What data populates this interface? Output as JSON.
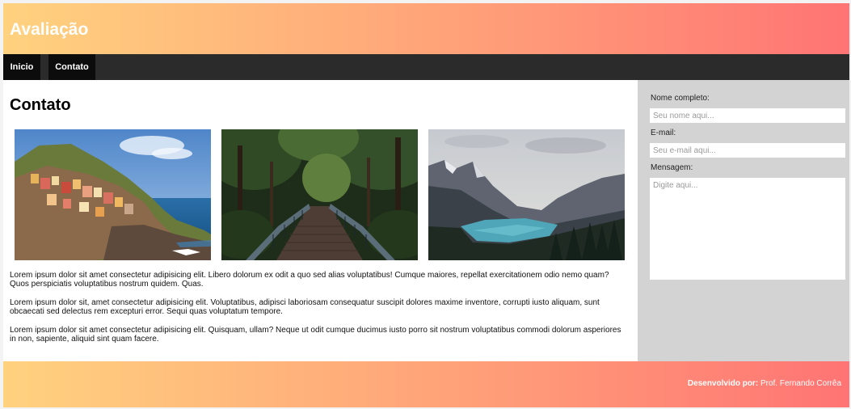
{
  "header": {
    "title": "Avaliação"
  },
  "nav": {
    "items": [
      {
        "label": "Inicio"
      },
      {
        "label": "Contato"
      }
    ]
  },
  "main": {
    "heading": "Contato",
    "images": [
      {
        "alt": "coastal cliff village"
      },
      {
        "alt": "bridge in forest"
      },
      {
        "alt": "mountain lake"
      }
    ],
    "paragraphs": [
      "Lorem ipsum dolor sit amet consectetur adipisicing elit. Libero dolorum ex odit a quo sed alias voluptatibus! Cumque maiores, repellat exercitationem odio nemo quam? Quos perspiciatis voluptatibus nostrum quidem. Quas.",
      "Lorem ipsum dolor sit, amet consectetur adipisicing elit. Voluptatibus, adipisci laboriosam consequatur suscipit dolores maxime inventore, corrupti iusto aliquam, sunt obcaecati sed delectus rem excepturi error. Sequi quas voluptatum tempore.",
      "Lorem ipsum dolor sit amet consectetur adipisicing elit. Quisquam, ullam? Neque ut odit cumque ducimus iusto porro sit nostrum voluptatibus commodi dolorum asperiores in non, sapiente, aliquid sint quam facere."
    ]
  },
  "form": {
    "name_label": "Nome completo:",
    "name_placeholder": "Seu nome aqui...",
    "email_label": "E-mail:",
    "email_placeholder": "Seu e-mail aqui...",
    "message_label": "Mensagem:",
    "message_placeholder": "Digite aqui..."
  },
  "footer": {
    "credit_prefix": "Desenvolvido por:",
    "credit_name": " Prof. Fernando Corrêa"
  },
  "colors": {
    "gradient_start": "#ffd27f",
    "gradient_end": "#ff7474",
    "nav_bg": "#2b2b2b",
    "sidebar_bg": "#d3d3d3"
  }
}
